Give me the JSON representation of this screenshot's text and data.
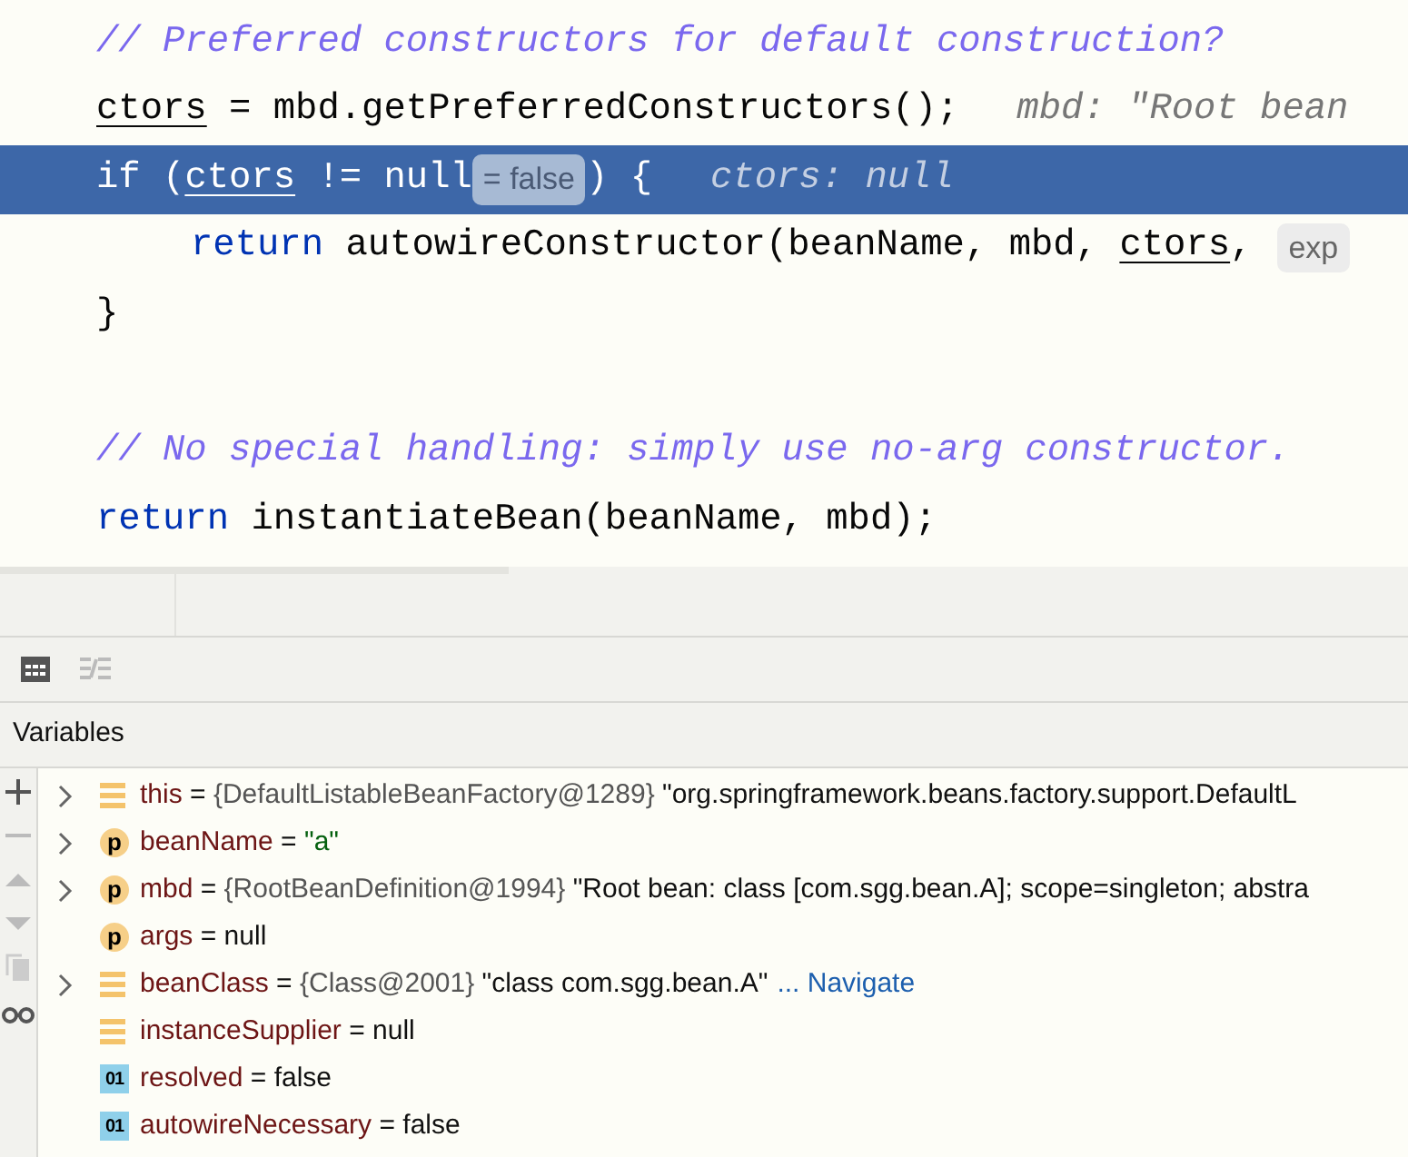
{
  "editor": {
    "lines": [
      {
        "highlighted": false,
        "indent": false,
        "tokens": [
          {
            "kind": "comment",
            "text": "// Preferred constructors for default construction?"
          }
        ]
      },
      {
        "highlighted": false,
        "indent": false,
        "tokens": [
          {
            "kind": "var",
            "text": "ctors"
          },
          {
            "kind": "plain",
            "text": " = mbd.getPreferredConstructors();"
          },
          {
            "kind": "hint",
            "text": "mbd: \"Root bean"
          }
        ]
      },
      {
        "highlighted": true,
        "indent": false,
        "tokens": [
          {
            "kind": "plain",
            "text": "if ("
          },
          {
            "kind": "var",
            "text": "ctors"
          },
          {
            "kind": "plain",
            "text": " != null"
          },
          {
            "kind": "inlay",
            "text": "= false"
          },
          {
            "kind": "plain",
            "text": ") {"
          },
          {
            "kind": "hint",
            "text": "ctors: null"
          }
        ]
      },
      {
        "highlighted": false,
        "indent": true,
        "tokens": [
          {
            "kind": "keyword",
            "text": "return"
          },
          {
            "kind": "plain",
            "text": " autowireConstructor(beanName, mbd, "
          },
          {
            "kind": "var",
            "text": "ctors"
          },
          {
            "kind": "plain",
            "text": ","
          },
          {
            "kind": "inlay",
            "text": "exp"
          }
        ]
      },
      {
        "highlighted": false,
        "indent": false,
        "tokens": [
          {
            "kind": "plain",
            "text": "}"
          }
        ]
      },
      {
        "highlighted": false
      },
      {
        "highlighted": false,
        "indent": false,
        "tokens": [
          {
            "kind": "comment",
            "text": "// No special handling: simply use no-arg constructor."
          }
        ]
      },
      {
        "highlighted": false,
        "indent": false,
        "tokens": [
          {
            "kind": "keyword",
            "text": "return"
          },
          {
            "kind": "plain",
            "text": " instantiateBean(beanName, mbd);"
          }
        ]
      }
    ]
  },
  "variables_panel": {
    "title": "Variables",
    "rows": [
      {
        "kind": "field",
        "expandable": true,
        "name": "this",
        "operator": "=",
        "type": "{DefaultListableBeanFactory@1289}",
        "value": "\"org.springframework.beans.factory.support.DefaultL",
        "is_string": false
      },
      {
        "kind": "parameter",
        "icon_label": "p",
        "expandable": true,
        "name": "beanName",
        "operator": "=",
        "value": "\"a\"",
        "is_string": true
      },
      {
        "kind": "parameter",
        "icon_label": "p",
        "expandable": true,
        "name": "mbd",
        "operator": "=",
        "type": "{RootBeanDefinition@1994}",
        "value": "\"Root bean: class [com.sgg.bean.A]; scope=singleton; abstra",
        "is_string": false
      },
      {
        "kind": "parameter",
        "icon_label": "p",
        "expandable": false,
        "name": "args",
        "operator": "=",
        "value": "null",
        "is_string": false
      },
      {
        "kind": "field",
        "expandable": true,
        "name": "beanClass",
        "operator": "=",
        "type": "{Class@2001}",
        "value": "\"class com.sgg.bean.A\"",
        "is_string": false,
        "link": "... Navigate"
      },
      {
        "kind": "field",
        "expandable": false,
        "name": "instanceSupplier",
        "operator": "=",
        "value": "null",
        "is_string": false
      },
      {
        "kind": "boolean",
        "icon_label": "01",
        "expandable": false,
        "name": "resolved",
        "operator": "=",
        "value": "false",
        "is_string": false
      },
      {
        "kind": "boolean",
        "icon_label": "01",
        "expandable": false,
        "name": "autowireNecessary",
        "operator": "=",
        "value": "false",
        "is_string": false
      }
    ]
  }
}
